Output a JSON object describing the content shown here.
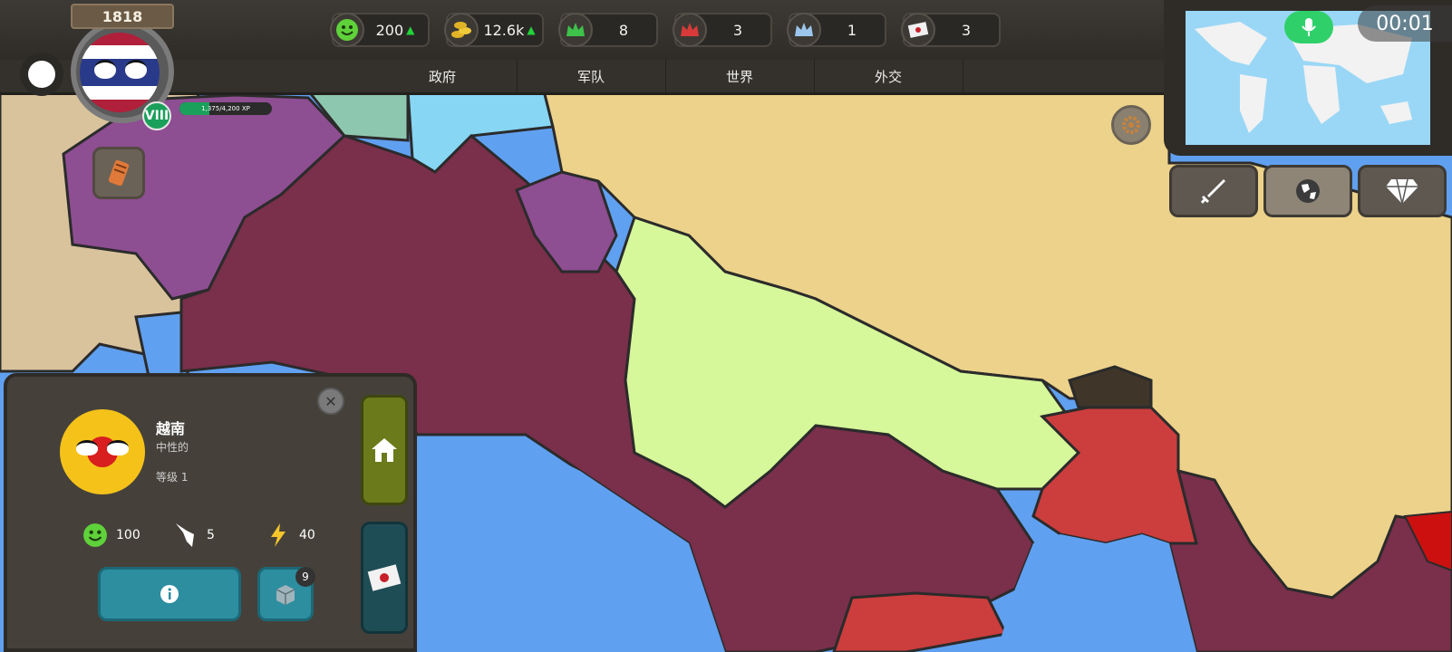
{
  "header": {
    "year": "1818",
    "level_roman": "VIII",
    "xp_text": "1,375/4,200 XP",
    "xp_progress": 0.327
  },
  "resources": [
    {
      "icon": "happiness-icon",
      "value": "200",
      "up": true
    },
    {
      "icon": "gold-coins-icon",
      "value": "12.6k",
      "up": true
    },
    {
      "icon": "green-crown-icon",
      "value": "8",
      "up": false
    },
    {
      "icon": "red-crown-icon",
      "value": "3",
      "up": false
    },
    {
      "icon": "blue-crown-icon",
      "value": "1",
      "up": false
    },
    {
      "icon": "diplomatic-letter-icon",
      "value": "3",
      "up": false
    }
  ],
  "tabs": [
    "政府",
    "军队",
    "世界",
    "外交"
  ],
  "timer": "00:01",
  "country_panel": {
    "name": "越南",
    "stance": "中性的",
    "level": "等级 1",
    "stats": {
      "happiness": "100",
      "influence": "5",
      "energy": "40"
    },
    "box_count": "9"
  },
  "colors": {
    "topbar": "#332f2b",
    "panel": "#45413a",
    "teal_button": "#2d8ea0",
    "home_button": "#6b7a1a",
    "sea": "#60a0f0",
    "maroon_country": "#7a2f4a",
    "purple_country": "#8e4e92",
    "tan_country": "#ecd28a",
    "lime_country": "#d6f79a",
    "red_country": "#cc3d3d"
  }
}
